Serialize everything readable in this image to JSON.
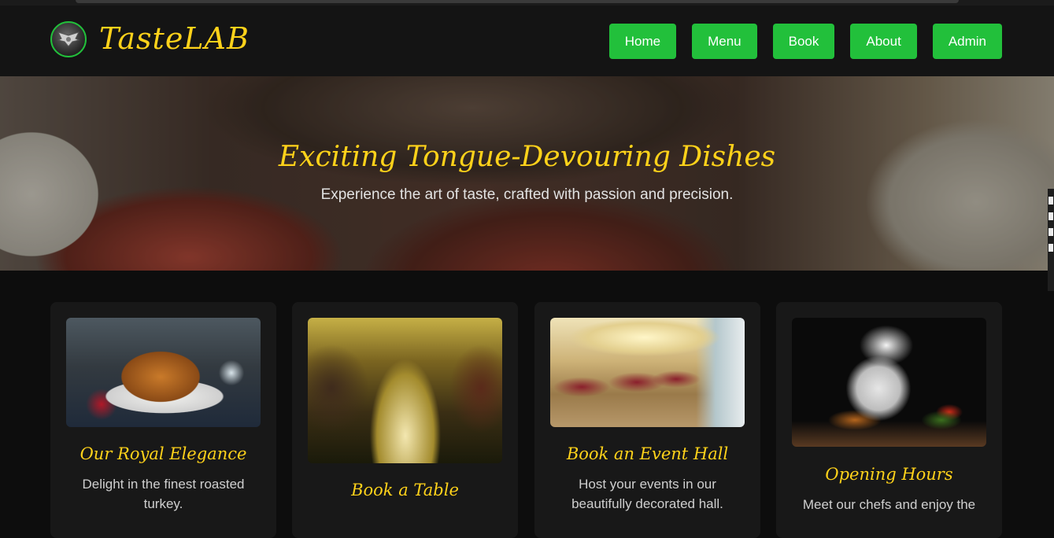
{
  "header": {
    "brand": "TasteLAB",
    "nav": [
      "Home",
      "Menu",
      "Book",
      "About",
      "Admin"
    ]
  },
  "hero": {
    "title": "Exciting Tongue-Devouring Dishes",
    "subtitle": "Experience the art of taste, crafted with passion and precision."
  },
  "cards": [
    {
      "title": "Our Royal Elegance",
      "desc": "Delight in the finest roasted turkey."
    },
    {
      "title": "Book a Table",
      "desc": ""
    },
    {
      "title": "Book an Event Hall",
      "desc": "Host your events in our beautifully decorated hall."
    },
    {
      "title": "Opening Hours",
      "desc": "Meet our chefs and enjoy the"
    }
  ],
  "colors": {
    "accent": "#22c03b",
    "gold": "#ffd21a",
    "background": "#0d0d0d"
  }
}
